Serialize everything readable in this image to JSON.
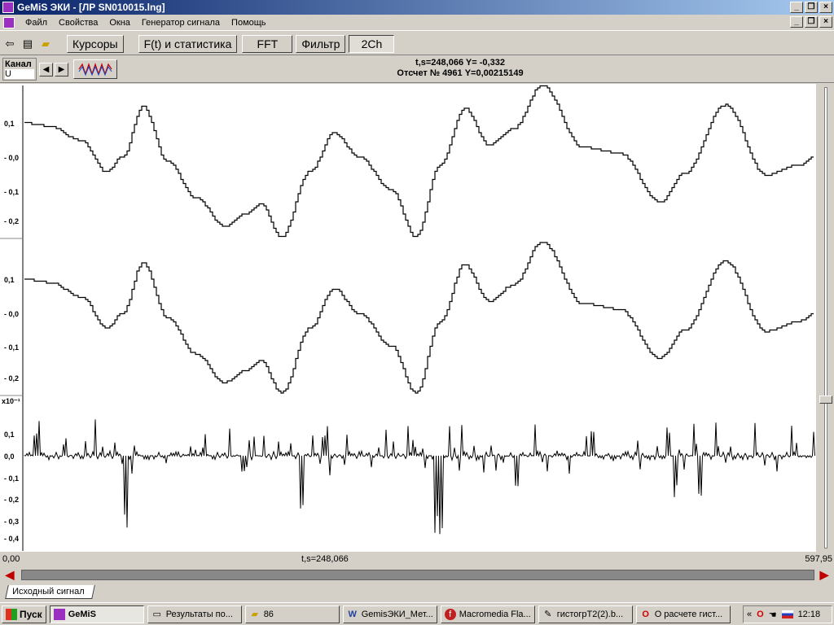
{
  "window": {
    "title": "GeMiS ЭКИ - [ЛР SN010015.lng]"
  },
  "menu": {
    "items": [
      "Файл",
      "Свойства",
      "Окна",
      "Генератор сигнала",
      "Помощь"
    ]
  },
  "toolbar": {
    "buttons": [
      "Курсоры",
      "F(t) и статистика",
      "FFT",
      "Фильтр",
      "2Ch"
    ],
    "pressed": "2Ch"
  },
  "channel": {
    "label": "Канал",
    "value": "U"
  },
  "readout": {
    "line1": "t,s=248,066  Y= -0,332",
    "line2": "Отсчет № 4961 Y=0,00215149"
  },
  "plots": {
    "top": {
      "ticks": [
        "0,1",
        "- 0,0",
        "- 0,1",
        "- 0,2"
      ]
    },
    "middle": {
      "ticks": [
        "0,1",
        "- 0,0",
        "- 0,1",
        "- 0,2"
      ]
    },
    "bottom": {
      "scale": "x10⁻¹",
      "ticks": [
        "0,1",
        "0,0",
        "- 0,1",
        "- 0,2",
        "- 0,3",
        "- 0,4"
      ]
    }
  },
  "xaxis": {
    "start": "0,00",
    "cursor": "t,s=248,066",
    "end": "597,95"
  },
  "tab": {
    "label": "Исходный сигнал"
  },
  "taskbar": {
    "start": "Пуск",
    "tasks": [
      "GeMiS",
      "Результаты по...",
      "86",
      "GemisЭКИ_Мет...",
      "Macromedia Fla...",
      "гистогрТ2(2).b...",
      "О расчете гист..."
    ],
    "clock": "12:18"
  },
  "colors": {
    "title_start": "#0a246a",
    "title_end": "#a6caf0",
    "accent_arrow": "#c00000",
    "face": "#d4d0c8"
  }
}
